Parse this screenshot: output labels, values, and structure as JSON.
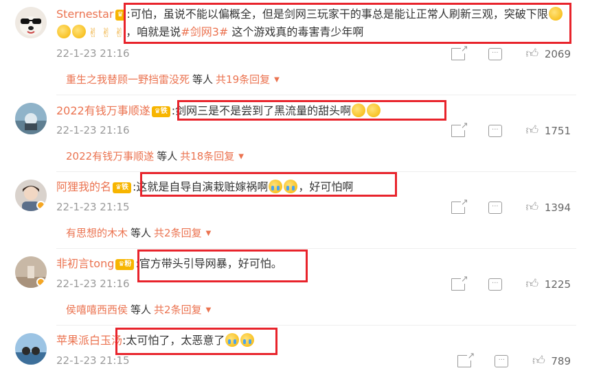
{
  "comments": [
    {
      "username": "Sternestar",
      "badge": "",
      "text1": ":可怕，虽说不能以偏概全，但是剑网三玩家干的事总是能让正常人刷新三观，突破下限",
      "text2a": "，咱就是说",
      "hashtag": "#剑网3#",
      "text2b": " 这个游戏真的毒害青少年啊",
      "time": "22-1-23 21:16",
      "likes": "2069",
      "reply_user": "重生之我替顾一野挡雷没死",
      "reply_etc": "等人",
      "reply_count": "共19条回复"
    },
    {
      "username": "2022有钱万事顺遂",
      "badge": "铁",
      "text": ":剑网三是不是尝到了黑流量的甜头啊",
      "time": "22-1-23 21:16",
      "likes": "1751",
      "reply_user": "2022有钱万事顺遂",
      "reply_etc": "等人",
      "reply_count": "共18条回复"
    },
    {
      "username": "阿狸我的名",
      "badge": "铁",
      "text": ":这就是自导自演栽赃嫁祸啊",
      "text_after": "，好可怕啊",
      "time": "22-1-23 21:15",
      "likes": "1394",
      "reply_user": "有思想的木木",
      "reply_etc": "等人",
      "reply_count": "共2条回复"
    },
    {
      "username": "非初言tong",
      "badge": "粉",
      "text": ":官方带头引导网暴，好可怕。",
      "time": "22-1-23 21:16",
      "likes": "1225",
      "reply_user": "侯嘻嘻西西侯",
      "reply_etc": "等人",
      "reply_count": "共2条回复"
    },
    {
      "username": "苹果派白玉汤",
      "badge": "",
      "text": ":太可怕了，太恶意了",
      "time": "22-1-23 21:15",
      "likes": "789"
    }
  ],
  "icons": {
    "share": "share-icon",
    "reply": "comment-icon",
    "like": "thumbs-up-icon",
    "more": "caret-down-icon"
  },
  "colors": {
    "username": "#eb7350",
    "highlight_box": "#e8232b",
    "meta": "#999999"
  }
}
